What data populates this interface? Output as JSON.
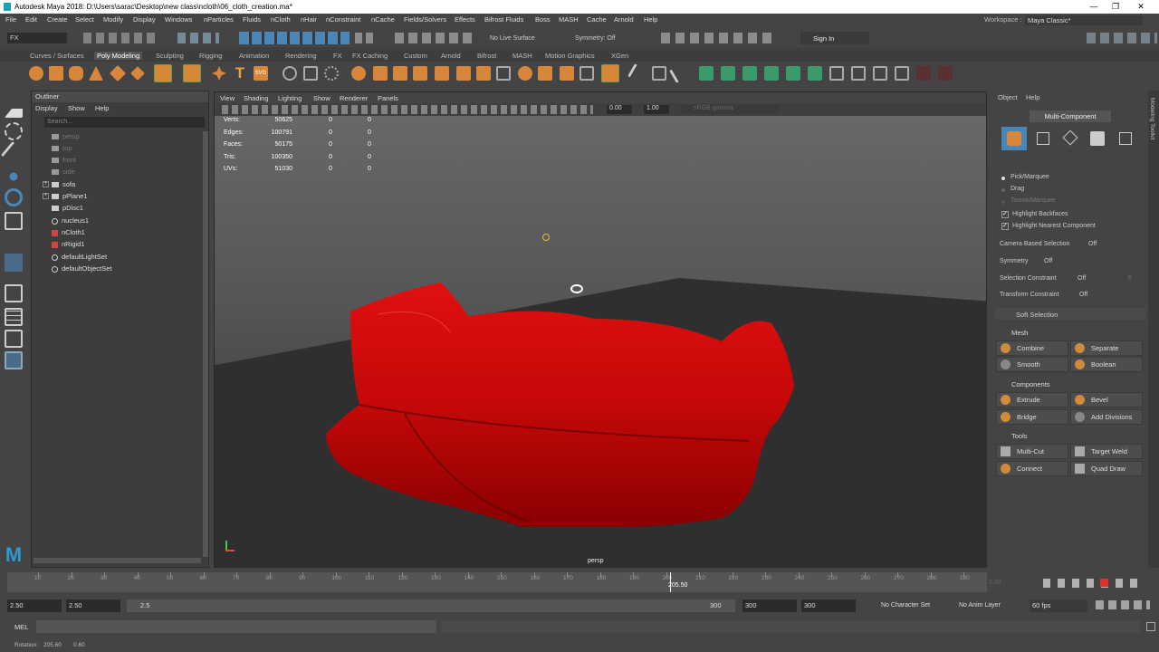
{
  "title": "Autodesk Maya 2018: D:\\Users\\sarac\\Desktop\\new class\\ncloth\\06_cloth_creation.ma*",
  "menu": [
    "File",
    "Edit",
    "Create",
    "Select",
    "Modify",
    "Display",
    "Windows",
    "nParticles",
    "Fluids",
    "nCloth",
    "nHair",
    "nConstraint",
    "nCache",
    "Fields/Solvers",
    "Effects",
    "Bifrost Fluids",
    "Boss",
    "MASH",
    "Cache",
    "Arnold",
    "Help"
  ],
  "workspace_label": "Workspace :",
  "workspace_value": "Maya Classic*",
  "status": {
    "menuset": "FX",
    "live": "No Live Surface",
    "symmetry": "Symmetry: Off",
    "signin": "Sign In"
  },
  "shelf_tabs": [
    "Curves / Surfaces",
    "Poly Modeling",
    "Sculpting",
    "Rigging",
    "Animation",
    "Rendering",
    "FX",
    "FX Caching",
    "Custom",
    "Arnold",
    "Bifrost",
    "MASH",
    "Motion Graphics",
    "XGen"
  ],
  "outliner": {
    "title": "Outliner",
    "menu": [
      "Display",
      "Show",
      "Help"
    ],
    "search": "Search...",
    "items": [
      "persp",
      "top",
      "front",
      "side",
      "sofa",
      "pPlane1",
      "pDisc1",
      "nucleus1",
      "nCloth1",
      "nRigid1",
      "defaultLightSet",
      "defaultObjectSet"
    ]
  },
  "viewport": {
    "menu": [
      "View",
      "Shading",
      "Lighting",
      "Show",
      "Renderer",
      "Panels"
    ],
    "exposure": "0.00",
    "gamma": "1.00",
    "colorspace": "sRGB gamma",
    "camera": "persp",
    "hud_rows": [
      {
        "label": "Verts:",
        "a": "50625",
        "b": "0",
        "c": "0"
      },
      {
        "label": "Edges:",
        "a": "100791",
        "b": "0",
        "c": "0"
      },
      {
        "label": "Faces:",
        "a": "50175",
        "b": "0",
        "c": "0"
      },
      {
        "label": "Tris:",
        "a": "100350",
        "b": "0",
        "c": "0"
      },
      {
        "label": "UVs:",
        "a": "51030",
        "b": "0",
        "c": "0"
      }
    ]
  },
  "right": {
    "menu": [
      "Object",
      "Help"
    ],
    "mode": "Multi-Component",
    "pick": "Pick/Marquee",
    "drag": "Drag",
    "tweak": "Tweak/Marquee",
    "hl_backfaces": "Highlight Backfaces",
    "hl_nearest": "Highlight Nearest Component",
    "cam_sel": "Camera Based Selection",
    "off": "Off",
    "symmetry": "Symmetry",
    "sel_constraint": "Selection Constraint",
    "xform_constraint": "Transform Constraint",
    "zero": "0",
    "soft": "Soft Selection",
    "mesh": "Mesh",
    "combine": "Combine",
    "separate": "Separate",
    "smooth": "Smooth",
    "boolean": "Boolean",
    "components": "Components",
    "extrude": "Extrude",
    "bevel": "Bevel",
    "bridge": "Bridge",
    "add_div": "Add Divisions",
    "tools": "Tools",
    "multicut": "Multi-Cut",
    "target_weld": "Target Weld",
    "connect": "Connect",
    "quad_draw": "Quad Draw",
    "side_label": "Modeling Toolkit"
  },
  "timeline": {
    "labels": [
      "10",
      "20",
      "30",
      "40",
      "50",
      "60",
      "70",
      "80",
      "90",
      "100",
      "110",
      "120",
      "130",
      "140",
      "150",
      "160",
      "170",
      "180",
      "190",
      "200",
      "210",
      "220",
      "230",
      "240",
      "250",
      "260",
      "270",
      "280",
      "290"
    ],
    "current": "205.50",
    "right_field": "2.50"
  },
  "range": {
    "start": "2.50",
    "start2": "2.50",
    "inner_start": "2.5",
    "inner_end": "300",
    "end": "300",
    "end2": "300",
    "charset": "No Character Set",
    "animlayer": "No Anim Layer",
    "fps": "60 fps"
  },
  "cmd": {
    "lang": "MEL"
  },
  "help": {
    "label": "Rotation:",
    "a": "205.60",
    "b": "0.60"
  }
}
